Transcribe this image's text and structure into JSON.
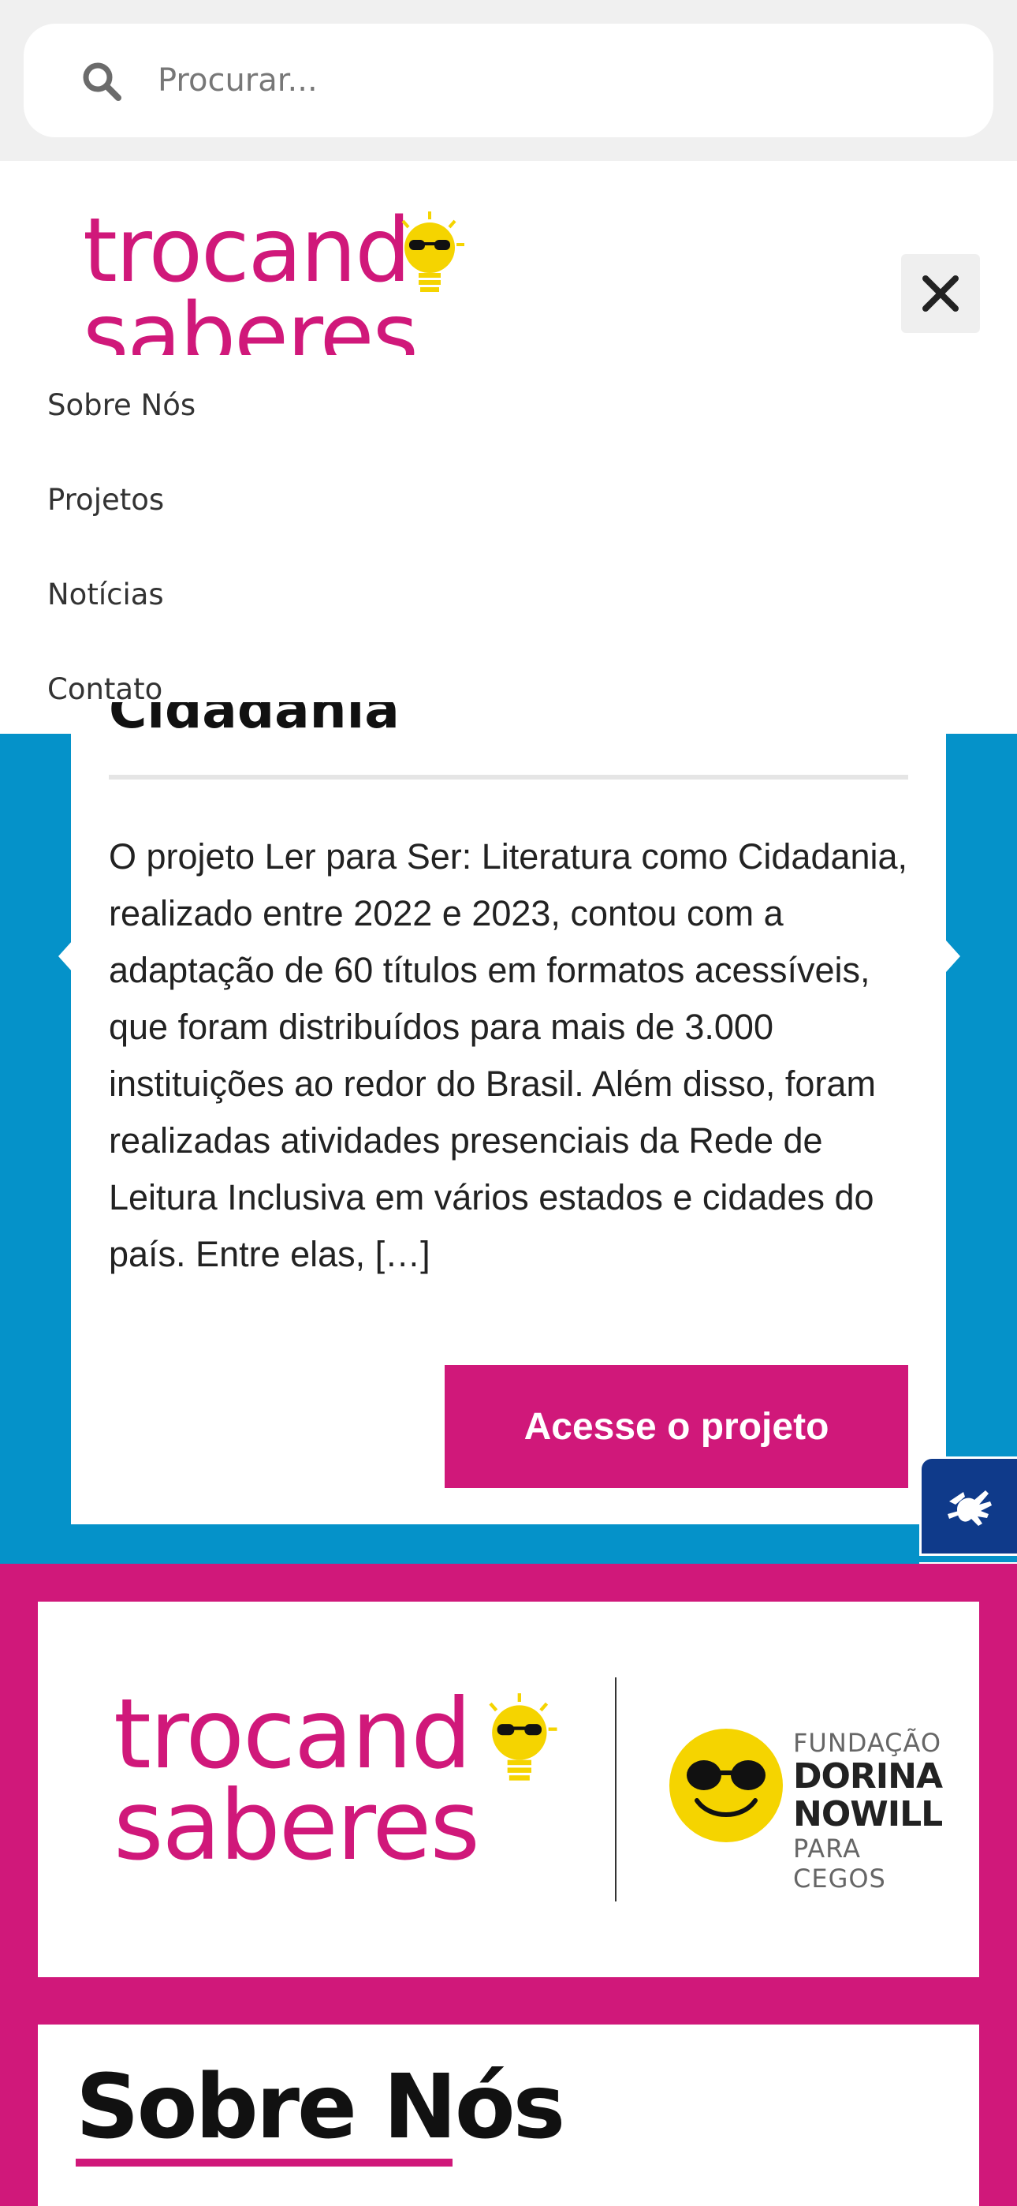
{
  "search": {
    "placeholder": "Procurar..."
  },
  "brand": {
    "logo_line1": "trocand",
    "logo_line2": "saberes",
    "pink": "#d0187a",
    "yellow": "#f5d400"
  },
  "header": {
    "close_icon": "close-icon"
  },
  "nav": {
    "items": [
      {
        "label": "Sobre Nós"
      },
      {
        "label": "Projetos"
      },
      {
        "label": "Notícias"
      },
      {
        "label": "Contato"
      }
    ]
  },
  "project": {
    "title": "Cidadania",
    "description": "O projeto Ler para Ser: Literatura como Cidadania, realizado entre 2022 e 2023, contou com a adaptação de 60 títulos em formatos acessíveis, que foram distribuídos para mais de 3.000 instituições ao redor do Brasil. Além disso, foram realizadas atividades presenciais da Rede de Leitura Inclusiva em vários estados e cidades do país. Entre elas, […]",
    "cta_label": "Acesse o projeto"
  },
  "accessibility": {
    "sign_language_icon": "sign-language-icon",
    "eye_icon": "eye-icon"
  },
  "partner": {
    "line1": "FUNDAÇÃO",
    "line2": "DORINA",
    "line3": "NOWILL",
    "line4": "PARA CEGOS"
  },
  "about": {
    "title": "Sobre Nós"
  },
  "colors": {
    "blue": "#0592c9",
    "pink": "#d0187a",
    "a11y_blue": "#0f3a8a"
  }
}
